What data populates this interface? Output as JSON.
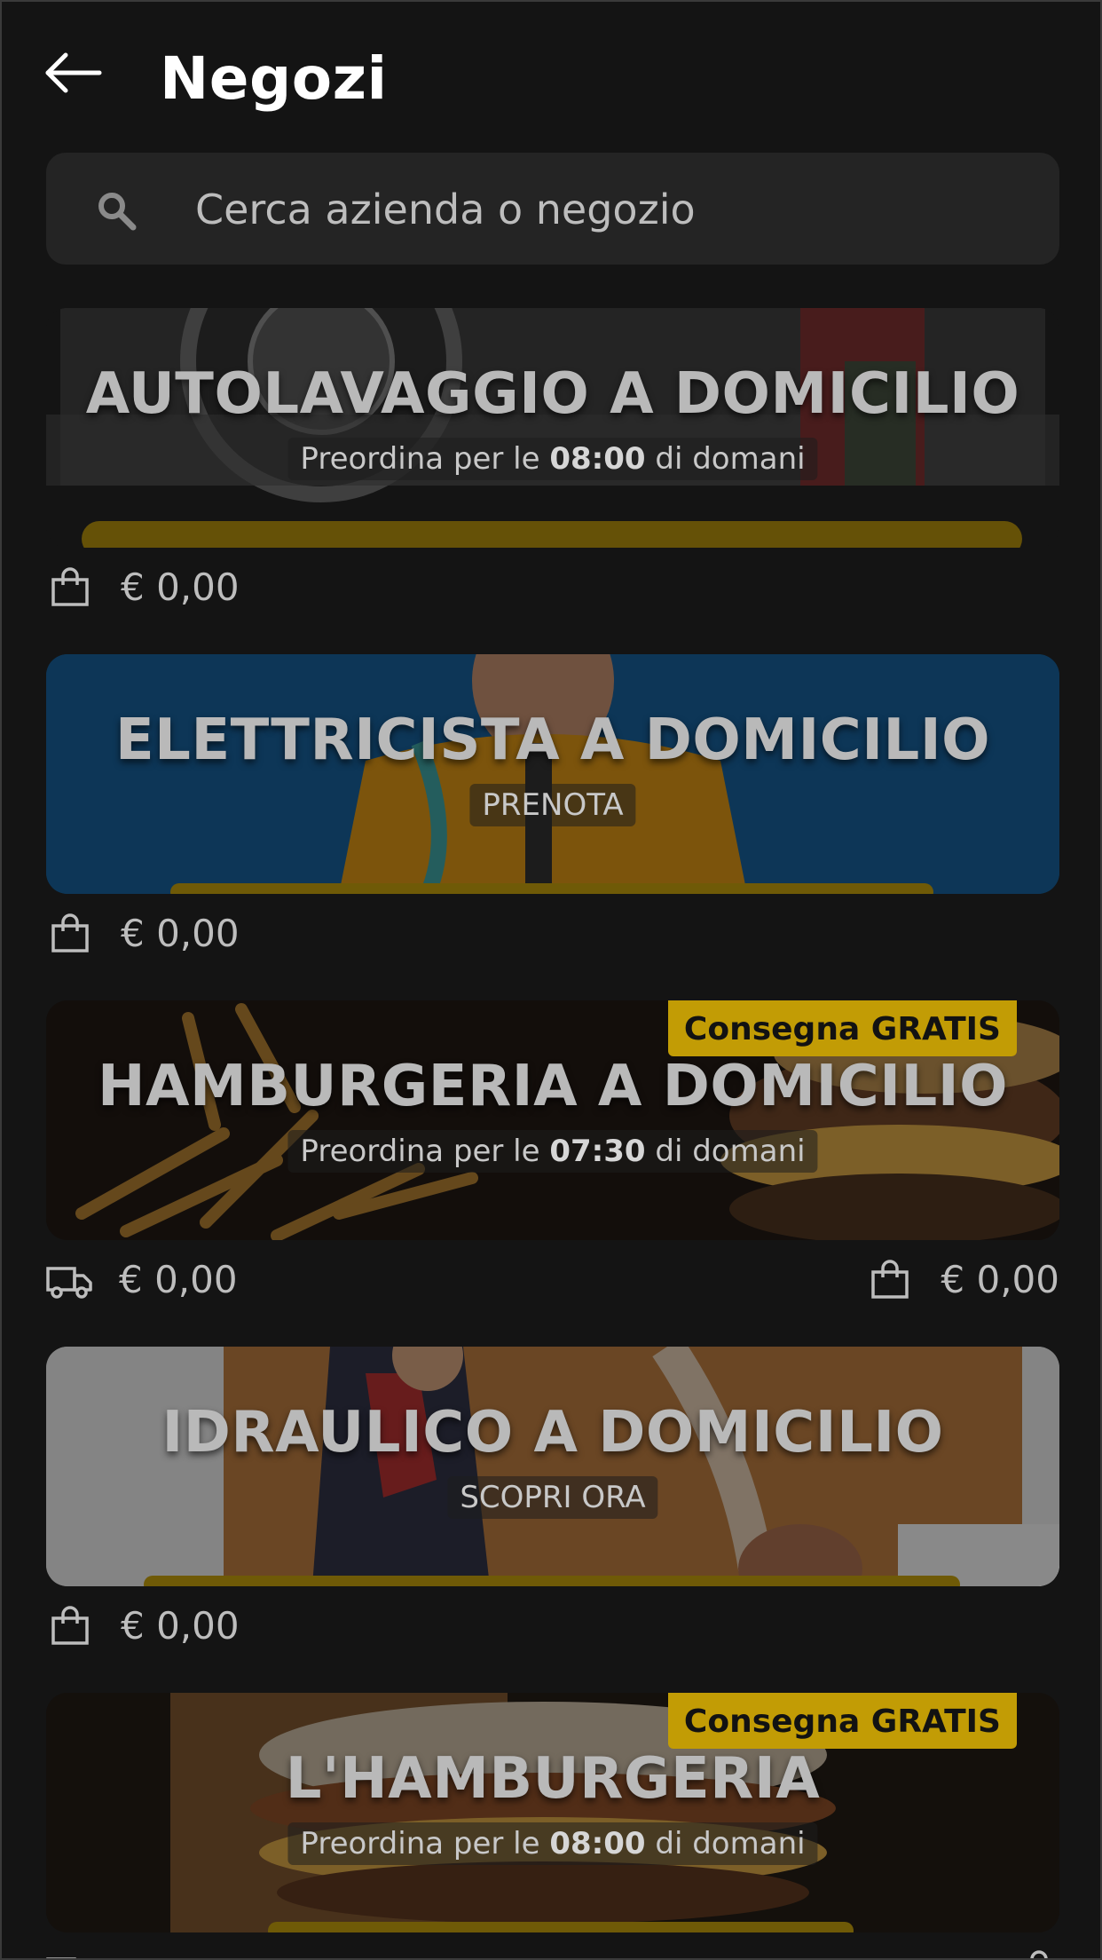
{
  "header": {
    "title": "Negozi",
    "back_icon": "arrow-left-icon"
  },
  "search": {
    "placeholder": "Cerca azienda o negozio",
    "icon": "search-icon"
  },
  "stores": [
    {
      "title": "AUTOLAVAGGIO A DOMICILIO",
      "subtitle_prefix": "Preordina per le ",
      "subtitle_time": "08:00",
      "subtitle_suffix": " di domani",
      "pickup_price": "€ 0,00"
    },
    {
      "title": "ELETTRICISTA A DOMICILIO",
      "subtitle": "PRENOTA",
      "pickup_price": "€ 0,00"
    },
    {
      "title": "HAMBURGERIA A DOMICILIO",
      "badge": "Consegna GRATIS",
      "subtitle_prefix": "Preordina per le ",
      "subtitle_time": "07:30",
      "subtitle_suffix": " di domani",
      "delivery_price": "€ 0,00",
      "pickup_price": "€ 0,00"
    },
    {
      "title": "IDRAULICO A DOMICILIO",
      "subtitle": "SCOPRI ORA",
      "pickup_price": "€ 0,00"
    },
    {
      "title": "L'HAMBURGERIA",
      "badge": "Consegna GRATIS",
      "subtitle_prefix": "Preordina per le ",
      "subtitle_time": "08:00",
      "subtitle_suffix": " di domani"
    }
  ],
  "colors": {
    "background": "#141414",
    "search_bg": "#242424",
    "badge_bg": "#c29c05",
    "text_muted": "#bdbdbd"
  }
}
